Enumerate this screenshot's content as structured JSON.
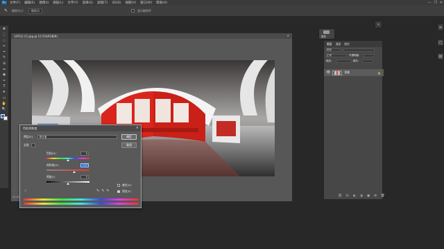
{
  "menubar": {
    "logo": "Ps",
    "items": [
      "文件(F)",
      "编辑(E)",
      "图像(I)",
      "图层(L)",
      "文字(Y)",
      "选择(S)",
      "滤镜(T)",
      "3D(D)",
      "视图(V)",
      "窗口(W)",
      "帮助(H)"
    ],
    "window_controls": [
      "—",
      "❐",
      "✕"
    ]
  },
  "options": {
    "sample_size_label": "取样大小：",
    "sample_size_value": "取样点",
    "sample_all_label": "显示取样环"
  },
  "tools": [
    "✥",
    "⬚",
    "◌",
    "✂",
    "⌖",
    "✎",
    "⊘",
    "⚌",
    "◉",
    "✑",
    "T",
    "➤",
    "▭",
    "✋",
    "🔍"
  ],
  "document": {
    "tab_title": "1(PG1) (1).jpg @ 12.5%(RGB/8)",
    "close": "×",
    "status": "12.5%"
  },
  "panel_icon_label": "属性",
  "layers_panel": {
    "tabs": [
      "图层",
      "通道",
      "路径"
    ],
    "filter_label": "类型",
    "blend_mode": "正常",
    "opacity_label": "不透明度：",
    "lock_label": "锁定：",
    "fill_label": "填充：",
    "layer_name": "背景",
    "eye": "👁",
    "lock": "🔒",
    "bottom_icons": [
      "⛓",
      "fx",
      "◐",
      "◑",
      "▣",
      "⊞",
      "🗑"
    ]
  },
  "dialog": {
    "title": "色相/饱和度",
    "close": "×",
    "preset_label": "预设(E)：",
    "preset_value": "默认值",
    "channel_value": "全图",
    "hue_label": "色相(H)：",
    "hue_value": "0",
    "saturation_label": "饱和度(A)：",
    "saturation_value": "+37",
    "lightness_label": "明度(I)：",
    "lightness_value": "0",
    "ok_label": "确定",
    "cancel_label": "取消",
    "colorize_label": "着色(O)",
    "preview_label": "预览(P)",
    "preview_checked": true,
    "colorize_checked": false,
    "hue_level": 0.5,
    "saturation_level": 0.64,
    "lightness_level": 0.5
  },
  "colors": {
    "accent_red": "#d8261c",
    "fg_swatch": "#1e6fd6",
    "bg_swatch": "#ffffff"
  }
}
